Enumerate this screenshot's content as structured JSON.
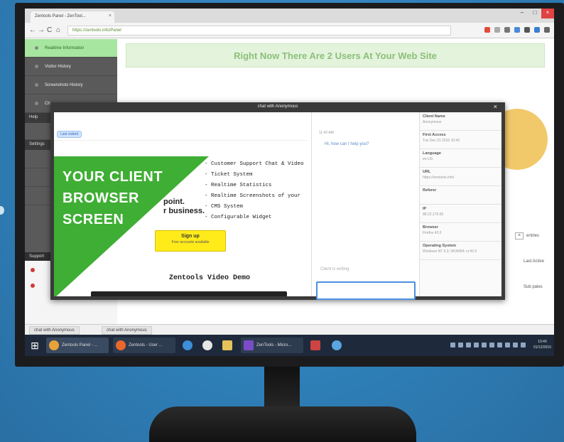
{
  "browser": {
    "tab_title": "Zentools Panel - ZenTool...",
    "tab_close": "×",
    "url": "https://zentools.info/Panel",
    "window_buttons": [
      "–",
      "□",
      "×"
    ],
    "nav": {
      "back": "←",
      "forward": "→",
      "reload": "C",
      "home": "⌂"
    }
  },
  "sidebar": {
    "items": [
      {
        "label": "Realtime Information",
        "active": true
      },
      {
        "label": "Visitor History",
        "active": false
      },
      {
        "label": "Screenshots History",
        "active": false
      },
      {
        "label": "Ch",
        "active": false
      }
    ],
    "section_help": "Help",
    "section_settings": "Settings",
    "support_header": "Support"
  },
  "main": {
    "banner": "Right Now There Are 2 Users At Your Web Site",
    "entries_label": "entries",
    "entries_box": "×",
    "text_right_1": "Last Active",
    "text_right_2": "Sub pales"
  },
  "dialog": {
    "title": "chat with Anonymous",
    "close": "×",
    "pill": "Last visited",
    "features": [
      "- Customer Support Chat & Video",
      "- Ticket System",
      "- Realtime Statistics",
      "- Realtime Screenshots of your",
      "- CMS System",
      "- Configurable Widget"
    ],
    "promo_line1": "point.",
    "promo_line2": "r business.",
    "signup_title": "Sign up",
    "signup_sub": "Free accounts available",
    "video_title": "Zentools Video Demo",
    "overlay_text": [
      "YOUR CLIENT",
      "BROWSER",
      "SCREEN"
    ],
    "chat_time": "11:42 AM",
    "chat_message": "Hi, how can I help you?",
    "typing": "Client is writing",
    "info": [
      {
        "k": "Client Name",
        "v": "Anonymous"
      },
      {
        "k": "First Access",
        "v": "Tue Dec 01 2015 10:43"
      },
      {
        "k": "Language",
        "v": "en-US"
      },
      {
        "k": "URL",
        "v": "https://zentools.info/"
      },
      {
        "k": "Referer",
        "v": ""
      },
      {
        "k": "IP",
        "v": "88.22.176.65"
      },
      {
        "k": "Browser",
        "v": "Firefox 42.0"
      },
      {
        "k": "Operating System",
        "v": "Windows NT 6.3; WOW64; rv:42.0"
      }
    ]
  },
  "chat_tabs": [
    "chat with Anonymous",
    "chat with Anonymous"
  ],
  "taskbar": {
    "start": "⊞",
    "items": [
      {
        "label": "Zentools Panel - ...",
        "color": "#e8a23a"
      },
      {
        "label": "Zentools - User ...",
        "color": "#e9682a"
      },
      {
        "label": "ZenTools - Micro...",
        "color": "#7b4cc8"
      }
    ],
    "clock_time": "10:49",
    "clock_date": "01/12/2015"
  },
  "colors": {
    "accent_green": "#3fae34",
    "banner_text": "#8cc07a",
    "signup_yellow": "#ffeb1a",
    "pie": "#f2c96a",
    "input_blue": "#4a90e2"
  }
}
